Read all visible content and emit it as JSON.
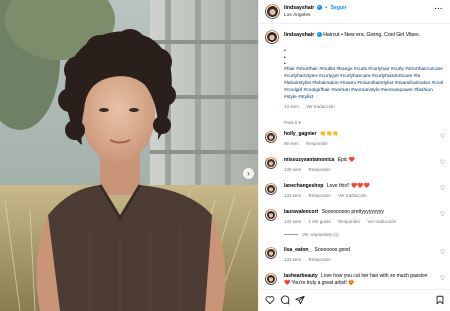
{
  "header": {
    "username": "lindsayshair",
    "follow_label": "Seguir",
    "location": "Los Ángeles",
    "more_icon": "more-horizontal-icon"
  },
  "caption": {
    "username": "lindsayshair",
    "text": "Haircut • New era. Giving. Cool Girl Vibes.",
    "bullets": [
      "•",
      "•",
      "•",
      "•"
    ],
    "hashtags": "#hair #shorthair #mullet #bangs #curls #curlyhair #curly #shorthaircutcare #curlyhairstyles #curlygirl #curlyhaircare #curlyhairdontcare #la #lahairstylist #lahairsalon #miami #miamihairstylist #miamihairsalon #cool #coolgirl #coolgirlhair #woman #womanstyle #womanpower #fashion #style #stylist",
    "age": "13 sem",
    "translate": "Ver traducción"
  },
  "para_ti_label": "Para ti ▾",
  "comments": [
    {
      "username": "holly_gagnier",
      "text": "👏👏👏",
      "age": "89 sem",
      "reply": "Responder"
    },
    {
      "username": "missuzysantamonica",
      "text": "Epic ❤️",
      "age": "130 sem",
      "reply": "Responder"
    },
    {
      "username": "lanechangeshop",
      "text": "Love this!! ❤️❤️❤️",
      "age": "133 sem",
      "reply": "Responder",
      "translate": "Ver traducción"
    },
    {
      "username": "lauravalencort",
      "text": "Sooooooooo prettyyyyyyyyy",
      "age": "133 sem",
      "likes": "1 Me gusta",
      "reply": "Responder",
      "translate": "Ver traducción",
      "replies_label": "Ver respuestas (1)"
    },
    {
      "username": "lisa_eaton_",
      "text": "Sooooooo good",
      "age": "133 sem",
      "reply": "Responder"
    },
    {
      "username": "lashearbeauty",
      "text": "Love how you cut her hair with so much passion ❤️ You're truly a great artist! 😍",
      "age": "",
      "reply": ""
    }
  ],
  "actions": {
    "like_icon": "heart-icon",
    "comment_icon": "comment-icon",
    "share_icon": "send-icon",
    "save_icon": "bookmark-icon"
  },
  "colors": {
    "link": "#00376b",
    "accent": "#0095f6",
    "meta": "#737373"
  }
}
